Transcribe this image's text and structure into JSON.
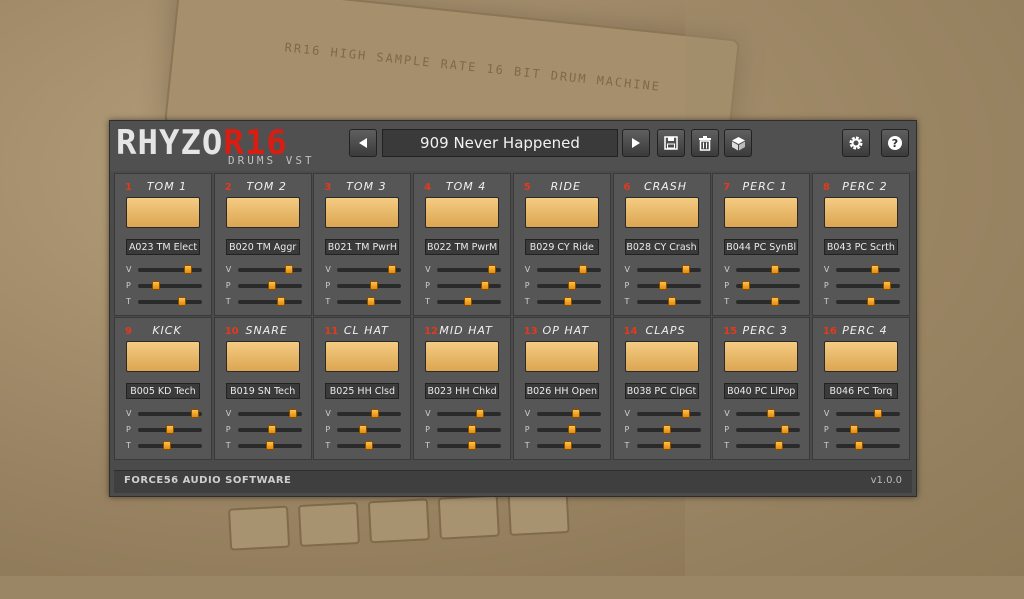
{
  "background": {
    "board_text": "RR16  HIGH SAMPLE RATE 16 BIT DRUM MACHINE"
  },
  "header": {
    "logo_part1": "RHYZO",
    "logo_part2": "R16",
    "logo_sub": "DRUMS VST",
    "preset_name": "909 Never Happened",
    "icons": {
      "prev": "triangle-left-icon",
      "next": "triangle-right-icon",
      "save": "floppy-disk-icon",
      "delete": "trash-icon",
      "random": "dice-icon",
      "settings": "gear-icon",
      "help": "question-mark-icon"
    }
  },
  "slider_labels": {
    "v": "V",
    "p": "P",
    "t": "T"
  },
  "channels": [
    {
      "num": "1",
      "name": "TOM 1",
      "sample": "A023 TM Elect",
      "v": 0.82,
      "p": 0.25,
      "t": 0.72
    },
    {
      "num": "2",
      "name": "TOM 2",
      "sample": "B020 TM Aggr",
      "v": 0.84,
      "p": 0.55,
      "t": 0.7
    },
    {
      "num": "3",
      "name": "TOM 3",
      "sample": "B021 TM PwrH",
      "v": 0.9,
      "p": 0.58,
      "t": 0.52
    },
    {
      "num": "4",
      "name": "TOM 4",
      "sample": "B022 TM PwrM",
      "v": 0.91,
      "p": 0.78,
      "t": 0.48
    },
    {
      "num": "5",
      "name": "RIDE",
      "sample": "B029 CY Ride",
      "v": 0.75,
      "p": 0.55,
      "t": 0.48
    },
    {
      "num": "6",
      "name": "CRASH",
      "sample": "B028 CY Crash",
      "v": 0.82,
      "p": 0.4,
      "t": 0.56
    },
    {
      "num": "7",
      "name": "PERC 1",
      "sample": "B044 PC SynBl",
      "v": 0.62,
      "p": 0.1,
      "t": 0.62
    },
    {
      "num": "8",
      "name": "PERC 2",
      "sample": "B043 PC Scrth",
      "v": 0.62,
      "p": 0.85,
      "t": 0.55
    },
    {
      "num": "9",
      "name": "KICK",
      "sample": "B005 KD Tech",
      "v": 0.95,
      "p": 0.5,
      "t": 0.45
    },
    {
      "num": "10",
      "name": "SNARE",
      "sample": "B019 SN Tech",
      "v": 0.92,
      "p": 0.55,
      "t": 0.5
    },
    {
      "num": "11",
      "name": "CL HAT",
      "sample": "B025 HH Clsd",
      "v": 0.6,
      "p": 0.38,
      "t": 0.5
    },
    {
      "num": "12",
      "name": "MID HAT",
      "sample": "B023 HH Chkd",
      "v": 0.7,
      "p": 0.55,
      "t": 0.55
    },
    {
      "num": "13",
      "name": "OP HAT",
      "sample": "B026 HH Open",
      "v": 0.62,
      "p": 0.55,
      "t": 0.48
    },
    {
      "num": "14",
      "name": "CLAPS",
      "sample": "B038 PC ClpGt",
      "v": 0.82,
      "p": 0.48,
      "t": 0.48
    },
    {
      "num": "15",
      "name": "PERC 3",
      "sample": "B040 PC LlPop",
      "v": 0.55,
      "p": 0.8,
      "t": 0.7
    },
    {
      "num": "16",
      "name": "PERC 4",
      "sample": "B046 PC Torq",
      "v": 0.68,
      "p": 0.25,
      "t": 0.35
    }
  ],
  "footer": {
    "company": "FORCE56 AUDIO SOFTWARE",
    "version": "v1.0.0"
  },
  "colors": {
    "accent_red": "#d81e12",
    "pad_orange": "#e8b566",
    "knob_orange": "#f0a020"
  }
}
